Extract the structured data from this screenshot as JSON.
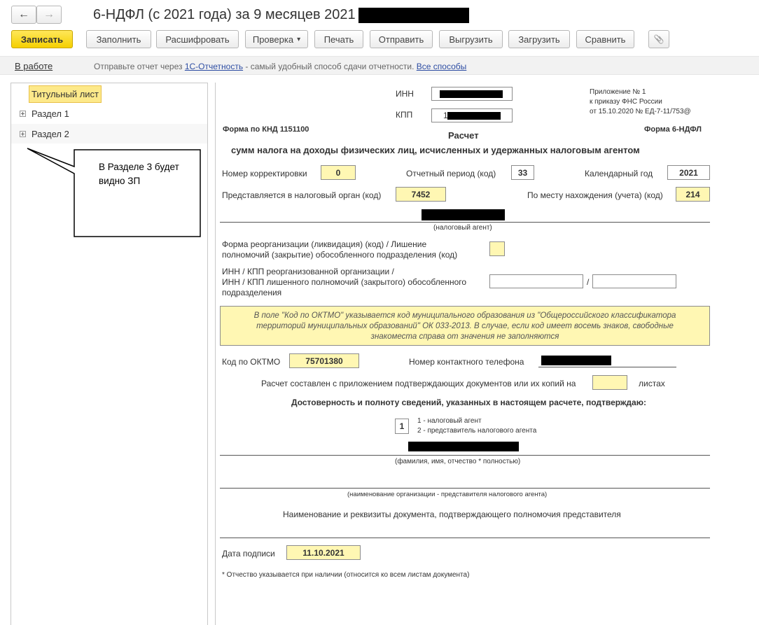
{
  "window": {
    "title": "6-НДФЛ (с 2021 года) за 9 месяцев 2021 г. "
  },
  "nav": {
    "back_icon": "←",
    "forward_icon": "→"
  },
  "toolbar": {
    "save_label": "Записать",
    "fill_label": "Заполнить",
    "decode_label": "Расшифровать",
    "check_label": "Проверка",
    "check_arrow": "▾",
    "print_label": "Печать",
    "send_label": "Отправить",
    "export_label": "Выгрузить",
    "import_label": "Загрузить",
    "compare_label": "Сравнить",
    "attach_icon": "📎"
  },
  "infobar": {
    "status_link": "В работе",
    "text_before": "Отправьте отчет через ",
    "service_link": "1С-Отчетность",
    "text_after": " - самый удобный способ сдачи отчетности. ",
    "all_methods_link": "Все способы"
  },
  "sidebar": {
    "items": [
      {
        "label": "Титульный лист"
      },
      {
        "label": "Раздел 1"
      },
      {
        "label": "Раздел 2"
      }
    ]
  },
  "callout": {
    "text": "В Разделе 3 будет видно ЗП"
  },
  "form": {
    "inn_label": "ИНН",
    "kpp_label": "КПП",
    "kpp_prefix": "1",
    "appendix_line1": "Приложение № 1",
    "appendix_line2": "к приказу ФНС России",
    "appendix_line3": "от 15.10.2020 № ЕД-7-11/753@",
    "knd_label": "Форма по КНД 1151100",
    "form_name": "Форма 6-НДФЛ",
    "title_line1": "Расчет",
    "title_line2": "сумм налога на доходы физических лиц, исчисленных и удержанных налоговым агентом",
    "correction_label": "Номер корректировки",
    "correction_value": "0",
    "period_label": "Отчетный период (код)",
    "period_value": "33",
    "year_label": "Календарный год",
    "year_value": "2021",
    "tax_authority_label": "Представляется в налоговый орган (код)",
    "tax_authority_value": "7452",
    "location_label": "По месту нахождения (учета) (код)",
    "location_value": "214",
    "agent_caption": "(налоговый агент)",
    "reorg_label_line1": "Форма реорганизации (ликвидация) (код) / Лишение",
    "reorg_label_line2": "полномочий (закрытие) обособленного подразделения (код)",
    "reorg_inn_line1": "ИНН / КПП реорганизованной организации /",
    "reorg_inn_line2": "ИНН / КПП лишенного полномочий (закрытого) обособленного",
    "reorg_inn_line3": "подразделения",
    "reorg_slash": "/",
    "note_line1": "В поле \"Код по ОКТМО\" указывается код муниципального образования из \"Общероссийского классификатора",
    "note_line2": "территорий муниципальных образований\" ОК 033-2013. В случае, если код имеет восемь знаков, свободные",
    "note_line3": "знакоместа справа от значения не заполняются",
    "oktmo_label": "Код по ОКТМО",
    "oktmo_value": "75701380",
    "phone_label": "Номер контактного телефона",
    "pages_label": "Расчет составлен с приложением подтверждающих документов или их копий на",
    "pages_suffix": "листах",
    "confirm_text": "Достоверность и полноту сведений, указанных в настоящем расчете, подтверждаю:",
    "signer_value": "1",
    "signer_opt1": "1 - налоговый агент",
    "signer_opt2": "2 - представитель налогового агента",
    "fio_caption": "(фамилия, имя, отчество * полностью)",
    "rep_org_caption": "(наименование организации - представителя налогового агента)",
    "rep_doc_text": "Наименование и реквизиты документа, подтверждающего полномочия представителя",
    "sign_date_label": "Дата подписи",
    "sign_date_value": "11.10.2021",
    "footnote": "* Отчество указывается при наличии (относится ко всем листам документа)"
  },
  "colors": {
    "accent_yellow": "#f5d000",
    "field_yellow": "#fff7b3",
    "link_blue": "#2d4da3"
  }
}
